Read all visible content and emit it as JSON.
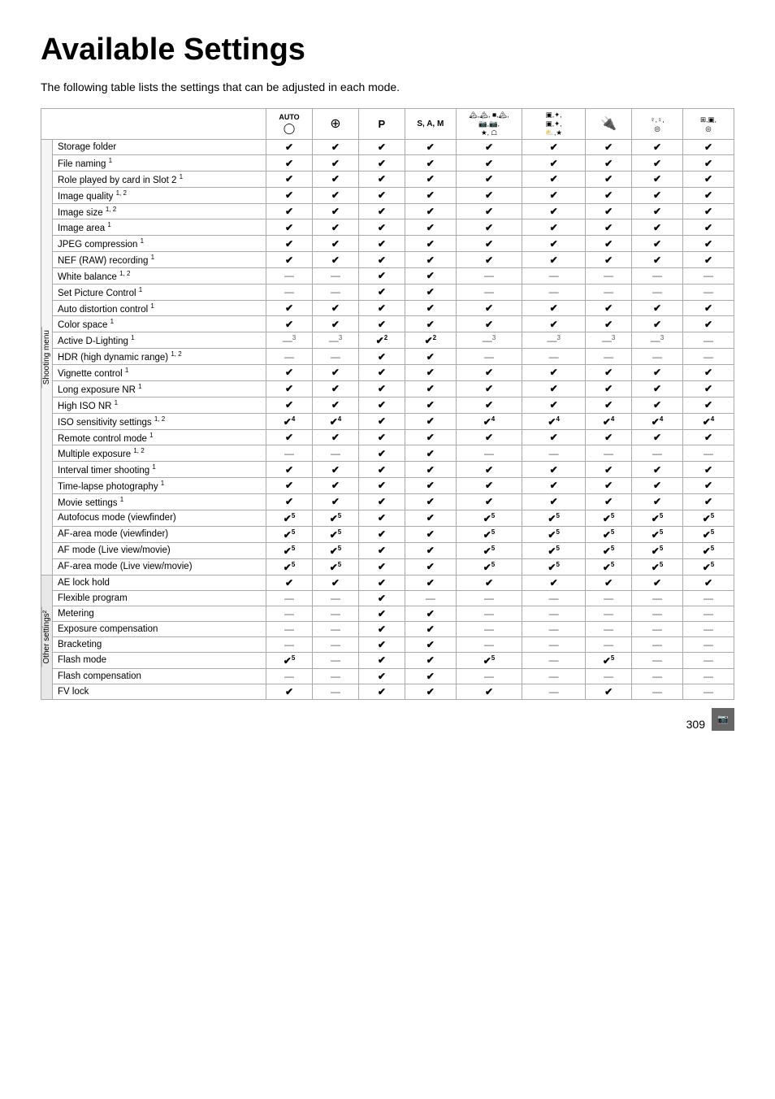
{
  "title": "Available Settings",
  "subtitle": "The following table lists the settings that can be adjusted in each mode.",
  "page_number": "309",
  "columns": [
    {
      "id": "auto",
      "label": "AUTO\n☐",
      "icon": "AUTO"
    },
    {
      "id": "scene",
      "label": "⊕",
      "icon": "⊕"
    },
    {
      "id": "p",
      "label": "P",
      "icon": "P"
    },
    {
      "id": "sam",
      "label": "S, A, M",
      "icon": "S,A,M"
    },
    {
      "id": "special",
      "label": "✿,✿,\n⛰,✈,\n✿,✶",
      "icon": "special"
    },
    {
      "id": "effects",
      "label": "▣,✦,\n▣,✦",
      "icon": "effects"
    },
    {
      "id": "wired",
      "label": "⚡",
      "icon": "⚡"
    },
    {
      "id": "portrait",
      "label": "♀,♀,\n◎",
      "icon": "portrait"
    },
    {
      "id": "landscape",
      "label": "⊞,▣,\n◎",
      "icon": "landscape"
    }
  ],
  "sections": [
    {
      "name": "Shooting menu",
      "rows": [
        {
          "label": "Storage folder",
          "values": [
            "✔",
            "✔",
            "✔",
            "✔",
            "✔",
            "✔",
            "✔",
            "✔",
            "✔"
          ]
        },
        {
          "label": "File naming",
          "sup": "1",
          "values": [
            "✔",
            "✔",
            "✔",
            "✔",
            "✔",
            "✔",
            "✔",
            "✔",
            "✔"
          ]
        },
        {
          "label": "Role played by card in Slot 2",
          "sup": "1",
          "values": [
            "✔",
            "✔",
            "✔",
            "✔",
            "✔",
            "✔",
            "✔",
            "✔",
            "✔"
          ]
        },
        {
          "label": "Image quality",
          "sup": "1, 2",
          "values": [
            "✔",
            "✔",
            "✔",
            "✔",
            "✔",
            "✔",
            "✔",
            "✔",
            "✔"
          ]
        },
        {
          "label": "Image size",
          "sup": "1, 2",
          "values": [
            "✔",
            "✔",
            "✔",
            "✔",
            "✔",
            "✔",
            "✔",
            "✔",
            "✔"
          ]
        },
        {
          "label": "Image area",
          "sup": "1",
          "values": [
            "✔",
            "✔",
            "✔",
            "✔",
            "✔",
            "✔",
            "✔",
            "✔",
            "✔"
          ]
        },
        {
          "label": "JPEG compression",
          "sup": "1",
          "values": [
            "✔",
            "✔",
            "✔",
            "✔",
            "✔",
            "✔",
            "✔",
            "✔",
            "✔"
          ]
        },
        {
          "label": "NEF (RAW) recording",
          "sup": "1",
          "values": [
            "✔",
            "✔",
            "✔",
            "✔",
            "✔",
            "✔",
            "✔",
            "✔",
            "✔"
          ]
        },
        {
          "label": "White balance",
          "sup": "1, 2",
          "values": [
            "—",
            "—",
            "✔",
            "✔",
            "—",
            "—",
            "—",
            "—",
            "—"
          ]
        },
        {
          "label": "Set Picture Control",
          "sup": "1",
          "values": [
            "—",
            "—",
            "✔",
            "✔",
            "—",
            "—",
            "—",
            "—",
            "—"
          ]
        },
        {
          "label": "Auto distortion control",
          "sup": "1",
          "values": [
            "✔",
            "✔",
            "✔",
            "✔",
            "✔",
            "✔",
            "✔",
            "✔",
            "✔"
          ]
        },
        {
          "label": "Color space",
          "sup": "1",
          "values": [
            "✔",
            "✔",
            "✔",
            "✔",
            "✔",
            "✔",
            "✔",
            "✔",
            "✔"
          ]
        },
        {
          "label": "Active D-Lighting",
          "sup": "1",
          "values": [
            "—³",
            "—³",
            "✔²",
            "✔²",
            "—³",
            "—³",
            "—³",
            "—³",
            "—"
          ]
        },
        {
          "label": "HDR (high dynamic range)",
          "sup": "1, 2",
          "values": [
            "—",
            "—",
            "✔",
            "✔",
            "—",
            "—",
            "—",
            "—",
            "—"
          ]
        },
        {
          "label": "Vignette control",
          "sup": "1",
          "values": [
            "✔",
            "✔",
            "✔",
            "✔",
            "✔",
            "✔",
            "✔",
            "✔",
            "✔"
          ]
        },
        {
          "label": "Long exposure NR",
          "sup": "1",
          "values": [
            "✔",
            "✔",
            "✔",
            "✔",
            "✔",
            "✔",
            "✔",
            "✔",
            "✔"
          ]
        },
        {
          "label": "High ISO NR",
          "sup": "1",
          "values": [
            "✔",
            "✔",
            "✔",
            "✔",
            "✔",
            "✔",
            "✔",
            "✔",
            "✔"
          ]
        },
        {
          "label": "ISO sensitivity settings",
          "sup": "1, 2",
          "values": [
            "✔⁴",
            "✔⁴",
            "✔",
            "✔",
            "✔⁴",
            "✔⁴",
            "✔⁴",
            "✔⁴",
            "✔⁴"
          ]
        },
        {
          "label": "Remote control mode",
          "sup": "1",
          "values": [
            "✔",
            "✔",
            "✔",
            "✔",
            "✔",
            "✔",
            "✔",
            "✔",
            "✔"
          ]
        },
        {
          "label": "Multiple exposure",
          "sup": "1, 2",
          "values": [
            "—",
            "—",
            "✔",
            "✔",
            "—",
            "—",
            "—",
            "—",
            "—"
          ]
        },
        {
          "label": "Interval timer shooting",
          "sup": "1",
          "values": [
            "✔",
            "✔",
            "✔",
            "✔",
            "✔",
            "✔",
            "✔",
            "✔",
            "✔"
          ]
        },
        {
          "label": "Time-lapse photography",
          "sup": "1",
          "values": [
            "✔",
            "✔",
            "✔",
            "✔",
            "✔",
            "✔",
            "✔",
            "✔",
            "✔"
          ]
        },
        {
          "label": "Movie settings",
          "sup": "1",
          "values": [
            "✔",
            "✔",
            "✔",
            "✔",
            "✔",
            "✔",
            "✔",
            "✔",
            "✔"
          ]
        },
        {
          "label": "Autofocus mode (viewfinder)",
          "sup": "",
          "values": [
            "✔⁵",
            "✔⁵",
            "✔",
            "✔",
            "✔⁵",
            "✔⁵",
            "✔⁵",
            "✔⁵",
            "✔⁵"
          ]
        },
        {
          "label": "AF-area mode (viewfinder)",
          "sup": "",
          "values": [
            "✔⁵",
            "✔⁵",
            "✔",
            "✔",
            "✔⁵",
            "✔⁵",
            "✔⁵",
            "✔⁵",
            "✔⁵"
          ]
        },
        {
          "label": "AF mode (Live view/movie)",
          "sup": "",
          "values": [
            "✔⁵",
            "✔⁵",
            "✔",
            "✔",
            "✔⁵",
            "✔⁵",
            "✔⁵",
            "✔⁵",
            "✔⁵"
          ]
        },
        {
          "label": "AF-area mode (Live view/movie)",
          "sup": "",
          "values": [
            "✔⁵",
            "✔⁵",
            "✔",
            "✔",
            "✔⁵",
            "✔⁵",
            "✔⁵",
            "✔⁵",
            "✔⁵"
          ]
        }
      ]
    },
    {
      "name": "Other settings²",
      "rows": [
        {
          "label": "AE lock hold",
          "sup": "",
          "values": [
            "✔",
            "✔",
            "✔",
            "✔",
            "✔",
            "✔",
            "✔",
            "✔",
            "✔"
          ]
        },
        {
          "label": "Flexible program",
          "sup": "",
          "values": [
            "—",
            "—",
            "✔",
            "—",
            "—",
            "—",
            "—",
            "—",
            "—"
          ]
        },
        {
          "label": "Metering",
          "sup": "",
          "values": [
            "—",
            "—",
            "✔",
            "✔",
            "—",
            "—",
            "—",
            "—",
            "—"
          ]
        },
        {
          "label": "Exposure compensation",
          "sup": "",
          "values": [
            "—",
            "—",
            "✔",
            "✔",
            "—",
            "—",
            "—",
            "—",
            "—"
          ]
        },
        {
          "label": "Bracketing",
          "sup": "",
          "values": [
            "—",
            "—",
            "✔",
            "✔",
            "—",
            "—",
            "—",
            "—",
            "—"
          ]
        },
        {
          "label": "Flash mode",
          "sup": "",
          "values": [
            "✔⁵",
            "—",
            "✔",
            "✔",
            "✔⁵",
            "—",
            "✔⁵",
            "—",
            "—"
          ]
        },
        {
          "label": "Flash compensation",
          "sup": "",
          "values": [
            "—",
            "—",
            "✔",
            "✔",
            "—",
            "—",
            "—",
            "—",
            "—"
          ]
        },
        {
          "label": "FV lock",
          "sup": "",
          "values": [
            "✔",
            "—",
            "✔",
            "✔",
            "✔",
            "—",
            "✔",
            "—",
            "—"
          ]
        }
      ]
    }
  ]
}
